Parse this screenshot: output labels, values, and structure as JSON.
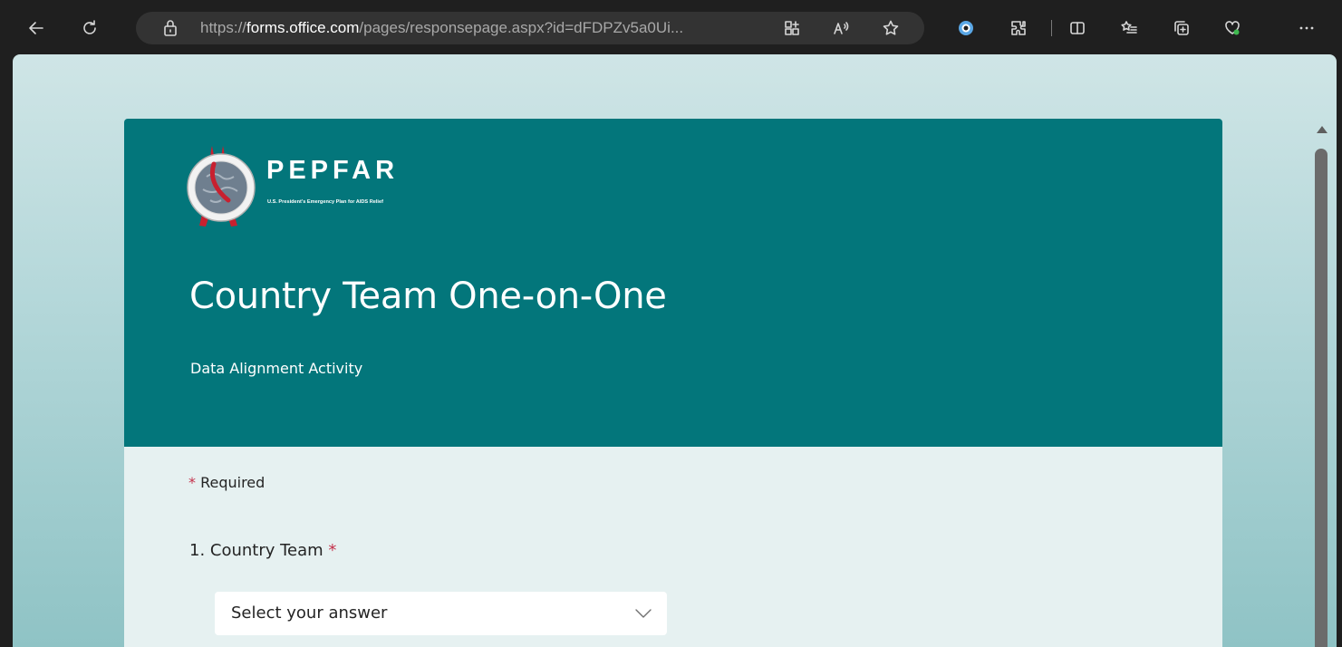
{
  "browser": {
    "url_prefix": "https://",
    "url_host": "forms.office.com",
    "url_path": "/pages/responsepage.aspx?id=dFDPZv5a0Ui...",
    "icons": [
      "back-arrow-icon",
      "refresh-icon",
      "lock-icon",
      "app-available-icon",
      "read-aloud-icon",
      "favorite-star-icon",
      "profile-icon",
      "extensions-icon",
      "split-screen-icon",
      "favorites-list-icon",
      "collections-icon",
      "browser-essentials-icon",
      "more-options-icon"
    ]
  },
  "form": {
    "logo_text": "PEPFAR",
    "logo_subtitle": "U.S. President's Emergency Plan for AIDS Relief",
    "title": "Country Team One-on-One",
    "subtitle": "Data Alignment Activity",
    "required_star": "*",
    "required_label": " Required",
    "questions": [
      {
        "number_label": "1. Country Team",
        "required_star": " *",
        "placeholder": "Select your answer"
      }
    ]
  },
  "colors": {
    "header": "#03767b",
    "required_star": "#c4314b",
    "card_body": "#e6f1f1"
  }
}
